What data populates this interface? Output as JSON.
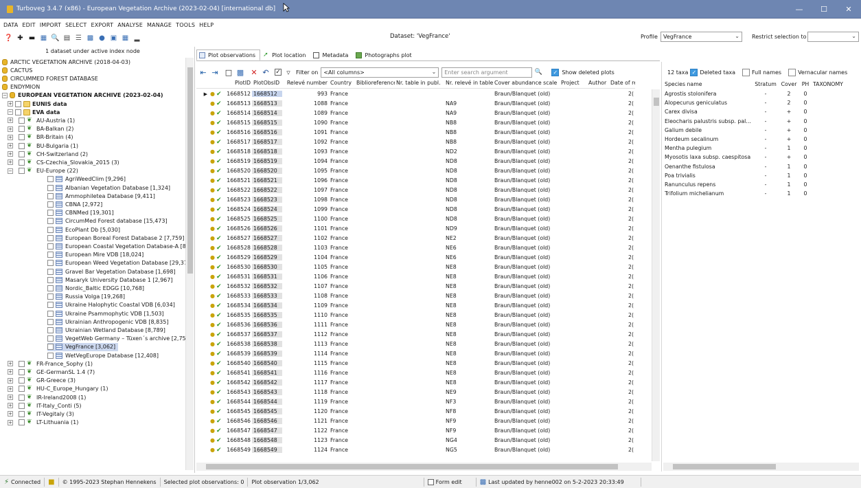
{
  "window": {
    "title": "Turboveg 3.4.7 (x86) - European Vegetation Archive (2023-02-04) [international db]",
    "min_glyph": "—",
    "max_glyph": "☐",
    "close_glyph": "✕"
  },
  "menu": [
    "DATA",
    "EDIT",
    "IMPORT",
    "SELECT",
    "EXPORT",
    "ANALYSE",
    "MANAGE",
    "TOOLS",
    "HELP"
  ],
  "toolbar": {
    "dataset_label": "Dataset: 'VegFrance'",
    "profile_label": "Profile",
    "profile_value": "VegFrance",
    "restrict_label": "Restrict selection to",
    "restrict_value": ""
  },
  "left_panel": {
    "header": "1 dataset under active index node",
    "tree": [
      {
        "label": "ARCTIC VEGETATION ARCHIVE (2018-04-03)",
        "level": 0,
        "type": "db",
        "bold": false
      },
      {
        "label": "CACTUS",
        "level": 0,
        "type": "db",
        "bold": false
      },
      {
        "label": "CIRCUMMED FOREST DATABASE",
        "level": 0,
        "type": "db",
        "bold": false
      },
      {
        "label": "ENDYMION",
        "level": 0,
        "type": "db",
        "bold": false
      },
      {
        "label": "EUROPEAN VEGETATION ARCHIVE (2023-02-04)",
        "level": 0,
        "type": "db",
        "bold": true,
        "expander": "−"
      },
      {
        "label": "EUNIS data",
        "level": 1,
        "type": "folder",
        "bold": true,
        "expander": "+"
      },
      {
        "label": "EVA data",
        "level": 1,
        "type": "folder",
        "bold": true,
        "expander": "−"
      },
      {
        "label": "AU-Austria  (1)",
        "level": 2,
        "type": "region",
        "expander": "+"
      },
      {
        "label": "BA-Balkan  (2)",
        "level": 2,
        "type": "region",
        "expander": "+"
      },
      {
        "label": "BR-Britain  (4)",
        "level": 2,
        "type": "region",
        "expander": "+"
      },
      {
        "label": "BU-Bulgaria  (1)",
        "level": 2,
        "type": "region",
        "expander": "+"
      },
      {
        "label": "CH-Switzerland  (2)",
        "level": 2,
        "type": "region",
        "expander": "+"
      },
      {
        "label": "CS-Czechia_Slovakia_2015  (3)",
        "level": 2,
        "type": "region",
        "expander": "+"
      },
      {
        "label": "EU-Europe  (22)",
        "level": 2,
        "type": "region",
        "expander": "−"
      },
      {
        "label": "AgriWeedClim  [9,296]",
        "level": 3,
        "type": "dataset"
      },
      {
        "label": "Albanian Vegetation Database  [1,324]",
        "level": 3,
        "type": "dataset"
      },
      {
        "label": "Ammophiletea Database  [9,411]",
        "level": 3,
        "type": "dataset"
      },
      {
        "label": "CBNA  [2,972]",
        "level": 3,
        "type": "dataset"
      },
      {
        "label": "CBNMed  [19,301]",
        "level": 3,
        "type": "dataset"
      },
      {
        "label": "CircumMed Forest database  [15,473]",
        "level": 3,
        "type": "dataset"
      },
      {
        "label": "EcoPlant Db  [5,030]",
        "level": 3,
        "type": "dataset"
      },
      {
        "label": "European Boreal Forest Database 2  [7,759]",
        "level": 3,
        "type": "dataset"
      },
      {
        "label": "European Coastal Vegetation Database-A  [8,",
        "level": 3,
        "type": "dataset"
      },
      {
        "label": "European Mire VDB  [18,024]",
        "level": 3,
        "type": "dataset"
      },
      {
        "label": "European Weed Vegetation Database  [29,37",
        "level": 3,
        "type": "dataset"
      },
      {
        "label": "Gravel Bar Vegetation Database  [1,698]",
        "level": 3,
        "type": "dataset"
      },
      {
        "label": "Masaryk University Database 1  [2,967]",
        "level": 3,
        "type": "dataset"
      },
      {
        "label": "Nordic_Baltic EDGG  [10,768]",
        "level": 3,
        "type": "dataset"
      },
      {
        "label": "Russia Volga  [19,268]",
        "level": 3,
        "type": "dataset"
      },
      {
        "label": "Ukraine Halophytic Coastal VDB  [6,034]",
        "level": 3,
        "type": "dataset"
      },
      {
        "label": "Ukraine Psammophytic VDB  [1,503]",
        "level": 3,
        "type": "dataset"
      },
      {
        "label": "Ukrainian Anthropogenic VDB  [8,835]",
        "level": 3,
        "type": "dataset"
      },
      {
        "label": "Ukrainian Wetland Database  [8,789]",
        "level": 3,
        "type": "dataset"
      },
      {
        "label": "VegetWeb Germany – Tüxen´s archive  [2,75",
        "level": 3,
        "type": "dataset"
      },
      {
        "label": "VegFrance  [3,062]",
        "level": 3,
        "type": "dataset",
        "selected": true
      },
      {
        "label": "WetVegEurope Database  [12,408]",
        "level": 3,
        "type": "dataset"
      },
      {
        "label": "FR-France_Sophy  (1)",
        "level": 2,
        "type": "region",
        "expander": "+"
      },
      {
        "label": "GE-GermanSL 1.4  (7)",
        "level": 2,
        "type": "region",
        "expander": "+"
      },
      {
        "label": "GR-Greece  (3)",
        "level": 2,
        "type": "region",
        "expander": "+"
      },
      {
        "label": "HU-C_Europe_Hungary  (1)",
        "level": 2,
        "type": "region",
        "expander": "+"
      },
      {
        "label": "IR-Ireland2008  (1)",
        "level": 2,
        "type": "region",
        "expander": "+"
      },
      {
        "label": "IT-Italy_Conti  (5)",
        "level": 2,
        "type": "region",
        "expander": "+"
      },
      {
        "label": "IT-Vegitaly  (3)",
        "level": 2,
        "type": "region",
        "expander": "+"
      },
      {
        "label": "LT-Lithuania  (1)",
        "level": 2,
        "type": "region",
        "expander": "+"
      }
    ]
  },
  "tabs": [
    "Plot observations",
    "Plot location",
    "Metadata",
    "Photographs plot"
  ],
  "obs_toolbar": {
    "filter_label": "Filter on",
    "filter_value": "<All columns>",
    "search_placeholder": "Enter search argument",
    "show_deleted_label": "Show deleted plots"
  },
  "plot_table": {
    "columns": [
      "PlotID",
      "PlotObsID",
      "Relevé number",
      "Country",
      "Biblioreference",
      "Nr. table in publ.",
      "Nr. relevé in table",
      "Cover abundance scale",
      "Project",
      "Author",
      "Date of reco"
    ],
    "rows": [
      [
        "1668512",
        "1668512",
        "993",
        "France",
        "",
        "",
        "",
        "Braun/Blanquet (old)",
        "",
        "",
        "2("
      ],
      [
        "1668513",
        "1668513",
        "1088",
        "France",
        "",
        "",
        "NA9",
        "Braun/Blanquet (old)",
        "",
        "",
        "2("
      ],
      [
        "1668514",
        "1668514",
        "1089",
        "France",
        "",
        "",
        "NA9",
        "Braun/Blanquet (old)",
        "",
        "",
        "2("
      ],
      [
        "1668515",
        "1668515",
        "1090",
        "France",
        "",
        "",
        "NB8",
        "Braun/Blanquet (old)",
        "",
        "",
        "2("
      ],
      [
        "1668516",
        "1668516",
        "1091",
        "France",
        "",
        "",
        "NB8",
        "Braun/Blanquet (old)",
        "",
        "",
        "2("
      ],
      [
        "1668517",
        "1668517",
        "1092",
        "France",
        "",
        "",
        "NB8",
        "Braun/Blanquet (old)",
        "",
        "",
        "2("
      ],
      [
        "1668518",
        "1668518",
        "1093",
        "France",
        "",
        "",
        "ND2",
        "Braun/Blanquet (old)",
        "",
        "",
        "2("
      ],
      [
        "1668519",
        "1668519",
        "1094",
        "France",
        "",
        "",
        "ND8",
        "Braun/Blanquet (old)",
        "",
        "",
        "2("
      ],
      [
        "1668520",
        "1668520",
        "1095",
        "France",
        "",
        "",
        "ND8",
        "Braun/Blanquet (old)",
        "",
        "",
        "2("
      ],
      [
        "1668521",
        "1668521",
        "1096",
        "France",
        "",
        "",
        "ND8",
        "Braun/Blanquet (old)",
        "",
        "",
        "2("
      ],
      [
        "1668522",
        "1668522",
        "1097",
        "France",
        "",
        "",
        "ND8",
        "Braun/Blanquet (old)",
        "",
        "",
        "2("
      ],
      [
        "1668523",
        "1668523",
        "1098",
        "France",
        "",
        "",
        "ND8",
        "Braun/Blanquet (old)",
        "",
        "",
        "2("
      ],
      [
        "1668524",
        "1668524",
        "1099",
        "France",
        "",
        "",
        "ND8",
        "Braun/Blanquet (old)",
        "",
        "",
        "2("
      ],
      [
        "1668525",
        "1668525",
        "1100",
        "France",
        "",
        "",
        "ND8",
        "Braun/Blanquet (old)",
        "",
        "",
        "2("
      ],
      [
        "1668526",
        "1668526",
        "1101",
        "France",
        "",
        "",
        "ND9",
        "Braun/Blanquet (old)",
        "",
        "",
        "2("
      ],
      [
        "1668527",
        "1668527",
        "1102",
        "France",
        "",
        "",
        "NE2",
        "Braun/Blanquet (old)",
        "",
        "",
        "2("
      ],
      [
        "1668528",
        "1668528",
        "1103",
        "France",
        "",
        "",
        "NE6",
        "Braun/Blanquet (old)",
        "",
        "",
        "2("
      ],
      [
        "1668529",
        "1668529",
        "1104",
        "France",
        "",
        "",
        "NE6",
        "Braun/Blanquet (old)",
        "",
        "",
        "2("
      ],
      [
        "1668530",
        "1668530",
        "1105",
        "France",
        "",
        "",
        "NE8",
        "Braun/Blanquet (old)",
        "",
        "",
        "2("
      ],
      [
        "1668531",
        "1668531",
        "1106",
        "France",
        "",
        "",
        "NE8",
        "Braun/Blanquet (old)",
        "",
        "",
        "2("
      ],
      [
        "1668532",
        "1668532",
        "1107",
        "France",
        "",
        "",
        "NE8",
        "Braun/Blanquet (old)",
        "",
        "",
        "2("
      ],
      [
        "1668533",
        "1668533",
        "1108",
        "France",
        "",
        "",
        "NE8",
        "Braun/Blanquet (old)",
        "",
        "",
        "2("
      ],
      [
        "1668534",
        "1668534",
        "1109",
        "France",
        "",
        "",
        "NE8",
        "Braun/Blanquet (old)",
        "",
        "",
        "2("
      ],
      [
        "1668535",
        "1668535",
        "1110",
        "France",
        "",
        "",
        "NE8",
        "Braun/Blanquet (old)",
        "",
        "",
        "2("
      ],
      [
        "1668536",
        "1668536",
        "1111",
        "France",
        "",
        "",
        "NE8",
        "Braun/Blanquet (old)",
        "",
        "",
        "2("
      ],
      [
        "1668537",
        "1668537",
        "1112",
        "France",
        "",
        "",
        "NE8",
        "Braun/Blanquet (old)",
        "",
        "",
        "2("
      ],
      [
        "1668538",
        "1668538",
        "1113",
        "France",
        "",
        "",
        "NE8",
        "Braun/Blanquet (old)",
        "",
        "",
        "2("
      ],
      [
        "1668539",
        "1668539",
        "1114",
        "France",
        "",
        "",
        "NE8",
        "Braun/Blanquet (old)",
        "",
        "",
        "2("
      ],
      [
        "1668540",
        "1668540",
        "1115",
        "France",
        "",
        "",
        "NE8",
        "Braun/Blanquet (old)",
        "",
        "",
        "2("
      ],
      [
        "1668541",
        "1668541",
        "1116",
        "France",
        "",
        "",
        "NE8",
        "Braun/Blanquet (old)",
        "",
        "",
        "2("
      ],
      [
        "1668542",
        "1668542",
        "1117",
        "France",
        "",
        "",
        "NE8",
        "Braun/Blanquet (old)",
        "",
        "",
        "2("
      ],
      [
        "1668543",
        "1668543",
        "1118",
        "France",
        "",
        "",
        "NE9",
        "Braun/Blanquet (old)",
        "",
        "",
        "2("
      ],
      [
        "1668544",
        "1668544",
        "1119",
        "France",
        "",
        "",
        "NF3",
        "Braun/Blanquet (old)",
        "",
        "",
        "2("
      ],
      [
        "1668545",
        "1668545",
        "1120",
        "France",
        "",
        "",
        "NF8",
        "Braun/Blanquet (old)",
        "",
        "",
        "2("
      ],
      [
        "1668546",
        "1668546",
        "1121",
        "France",
        "",
        "",
        "NF9",
        "Braun/Blanquet (old)",
        "",
        "",
        "2("
      ],
      [
        "1668547",
        "1668547",
        "1122",
        "France",
        "",
        "",
        "NF9",
        "Braun/Blanquet (old)",
        "",
        "",
        "2("
      ],
      [
        "1668548",
        "1668548",
        "1123",
        "France",
        "",
        "",
        "NG4",
        "Braun/Blanquet (old)",
        "",
        "",
        "2("
      ],
      [
        "1668549",
        "1668549",
        "1124",
        "France",
        "",
        "",
        "NG5",
        "Braun/Blanquet (old)",
        "",
        "",
        "2("
      ]
    ]
  },
  "species_panel": {
    "taxa_count": "12 taxa",
    "deleted_taxa_label": "Deleted taxa",
    "full_names_label": "Full names",
    "vernacular_label": "Vernacular names",
    "columns": [
      "Species name",
      "Stratum",
      "Cover",
      "PH",
      "TAXONOMY"
    ],
    "rows": [
      [
        "Agrostis stolonifera",
        "-",
        "2",
        "0",
        ""
      ],
      [
        "Alopecurus geniculatus",
        "-",
        "2",
        "0",
        ""
      ],
      [
        "Carex divisa",
        "-",
        "+",
        "0",
        ""
      ],
      [
        "Eleocharis palustris subsp. pal…",
        "-",
        "+",
        "0",
        ""
      ],
      [
        "Galium debile",
        "-",
        "+",
        "0",
        ""
      ],
      [
        "Hordeum secalinum",
        "-",
        "+",
        "0",
        ""
      ],
      [
        "Mentha pulegium",
        "-",
        "1",
        "0",
        ""
      ],
      [
        "Myosotis laxa subsp. caespitosa",
        "-",
        "+",
        "0",
        ""
      ],
      [
        "Oenanthe fistulosa",
        "-",
        "1",
        "0",
        ""
      ],
      [
        "Poa trivialis",
        "-",
        "1",
        "0",
        ""
      ],
      [
        "Ranunculus repens",
        "-",
        "1",
        "0",
        ""
      ],
      [
        "Trifolium michelianum",
        "-",
        "1",
        "0",
        ""
      ]
    ]
  },
  "status": {
    "connected": "Connected",
    "copyright": "© 1995-2023 Stephan Hennekens",
    "selected_obs": "Selected plot observations: 0",
    "plot_obs": "Plot observation 1/3,062",
    "form_edit": "Form edit",
    "last_updated": "Last updated by henne002 on 5-2-2023 20:33:49"
  },
  "colors": {
    "titlebar": "#6e86b2",
    "selection": "#ccd8ef",
    "checkbox_on": "#3f9ae0",
    "db_icon": "#e8b52a"
  }
}
